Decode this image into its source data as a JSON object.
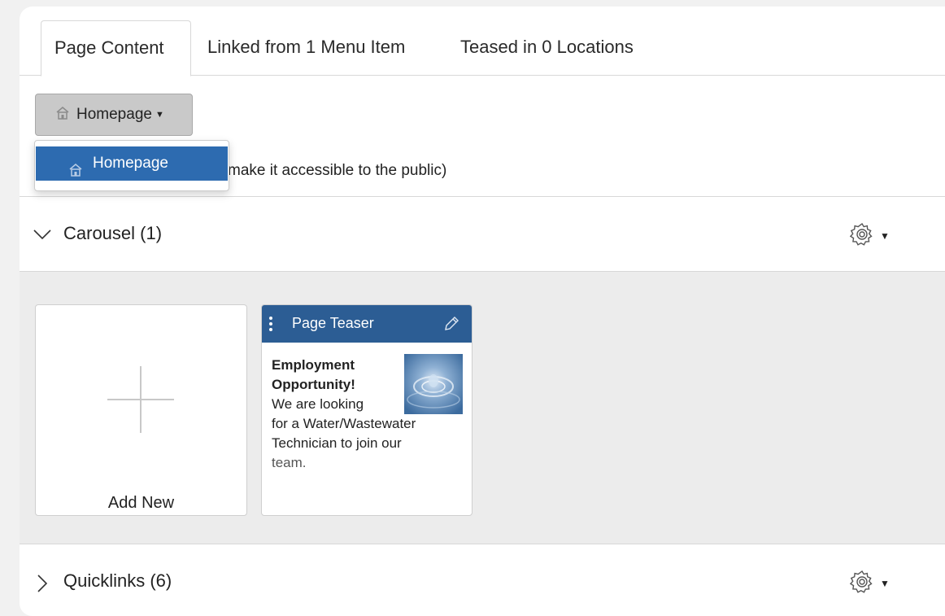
{
  "tabs": [
    {
      "label": "Page Content",
      "active": true
    },
    {
      "label": "Linked from 1 Menu Item",
      "active": false
    },
    {
      "label": "Teased in 0 Locations",
      "active": false
    }
  ],
  "site_dropdown": {
    "selected": "Homepage",
    "options": [
      "Homepage"
    ]
  },
  "hint_text": "make it accessible to the public)",
  "sections": {
    "carousel": {
      "title": "Carousel (1)",
      "expanded": true
    },
    "quicklinks": {
      "title": "Quicklinks (6)",
      "expanded": false
    }
  },
  "add_card": {
    "label": "Add New"
  },
  "teaser_card": {
    "header": "Page Teaser",
    "title": "Employment Opportunity!",
    "body_lines": [
      "We are looking",
      "for a Water/Wastewater",
      "Technician to join our",
      "team."
    ]
  },
  "colors": {
    "accent_blue": "#2d6bb0",
    "teaser_header": "#2c5d94",
    "content_bg": "#ececec"
  }
}
